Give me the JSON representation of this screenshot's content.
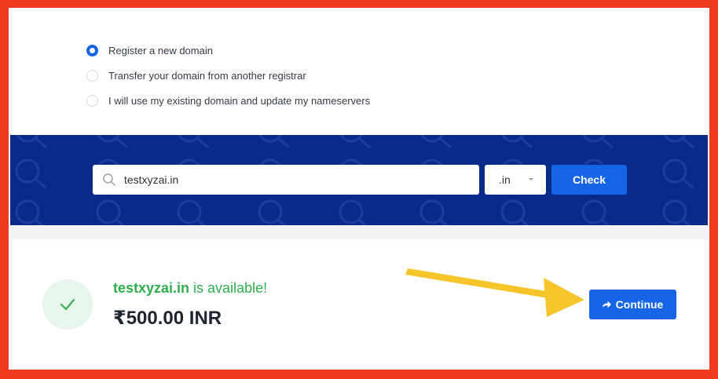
{
  "domain_options": [
    {
      "label": "Register a new domain",
      "checked": true
    },
    {
      "label": "Transfer your domain from another registrar",
      "checked": false
    },
    {
      "label": "I will use my existing domain and update my nameservers",
      "checked": false
    }
  ],
  "search": {
    "value": "testxyzai.in",
    "tld": ".in",
    "check_label": "Check"
  },
  "result": {
    "domain": "testxyzai.in",
    "status_text": " is available!",
    "price": "₹500.00 INR",
    "continue_label": "Continue"
  },
  "colors": {
    "frame_border": "#ee3a1e",
    "band": "#0a2a8a",
    "accent": "#1565e6",
    "available": "#2fae4e",
    "annotation_arrow": "#f6c52c"
  },
  "icons": {
    "search": "search-icon",
    "check": "checkmark-icon",
    "continue": "share-arrow-icon",
    "tld_caret": "caret-down-icon"
  }
}
